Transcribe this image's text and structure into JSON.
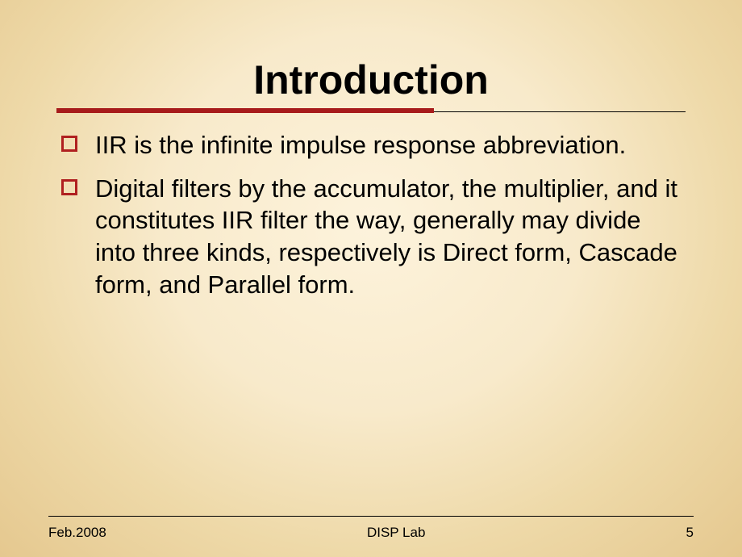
{
  "title": "Introduction",
  "bullets": [
    "IIR is the infinite impulse response abbreviation.",
    "Digital filters by the accumulator, the multiplier, and it constitutes IIR filter the way, generally may divide into three kinds, respectively is Direct form, Cascade form, and Parallel form."
  ],
  "footer": {
    "date": "Feb.2008",
    "center": "DISP Lab",
    "page": "5"
  },
  "colors": {
    "accent": "#a71b1b",
    "bullet_border": "#b02020"
  }
}
